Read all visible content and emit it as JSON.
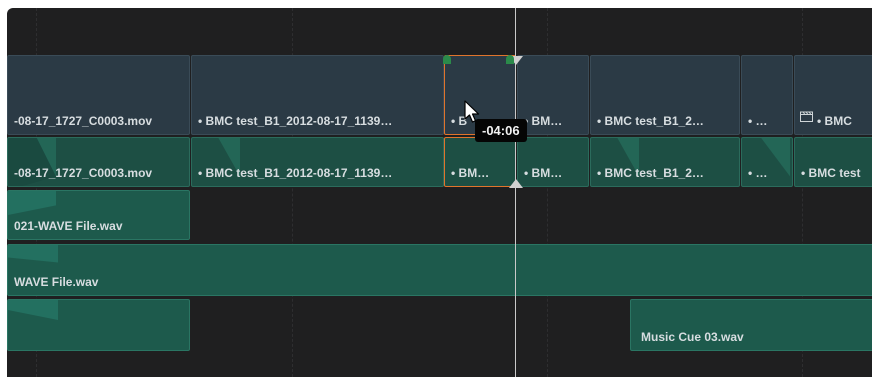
{
  "tooltip": {
    "offset": "-04:06"
  },
  "v2_clips": [
    {
      "label": "-08-17_1727_C0003.mov"
    },
    {
      "label": "• BMC test_B1_2012-08-17_1139…"
    },
    {
      "label": "• B"
    },
    {
      "label": "• BM…"
    },
    {
      "label": "• BMC test_B1_2…"
    },
    {
      "label": "• …"
    },
    {
      "label": "• BMC"
    }
  ],
  "v1_clips": [
    {
      "label": "-08-17_1727_C0003.mov"
    },
    {
      "label": "• BMC test_B1_2012-08-17_1139…"
    },
    {
      "label": "• BM…"
    },
    {
      "label": "• BM…"
    },
    {
      "label": "• BMC test_B1_2…"
    },
    {
      "label": "• …"
    },
    {
      "label": "• BMC test"
    }
  ],
  "audio_clips": [
    {
      "label": "021-WAVE File.wav"
    },
    {
      "label": "WAVE File.wav"
    },
    {
      "label": ""
    },
    {
      "label": "Music Cue 03.wav"
    }
  ],
  "colors": {
    "selection": "#e0742c",
    "video": "#2b3a45",
    "audio": "#1d5a4c"
  }
}
